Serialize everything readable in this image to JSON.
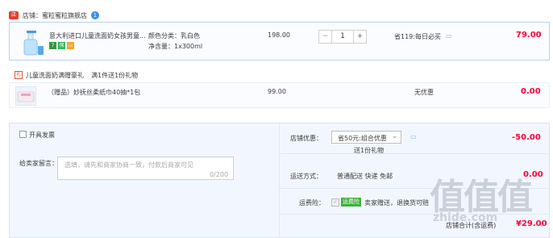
{
  "shop": {
    "label": "店铺：蜜粒蜜粒旗舰店",
    "icon": "shop-icon",
    "badge": "1"
  },
  "item": {
    "title": "意大利进口儿童洗面奶女孩男童...",
    "spec_color": "颜色分类：乳白色",
    "spec_volume": "净含量：1x300ml",
    "unit_price": "198.00",
    "quantity": "1",
    "promo": "省119:每日必买",
    "total": "79.00"
  },
  "gift_section": {
    "title": "儿童洗面奶满赠豪礼",
    "rule": "满1件送1份礼物",
    "gift_name": "（赠品）妙抚丝柔纸巾40抽*1包",
    "gift_price": "99.00",
    "gift_note": "无优惠",
    "gift_total": "0.00"
  },
  "invoice": {
    "label": "开具发票"
  },
  "message": {
    "label": "给卖家留言：",
    "placeholder": "选填，请先和商家协商一致，付款后商家可见",
    "counter": "0/200"
  },
  "discount": {
    "label": "店铺优惠：",
    "selected": "省50元:组合优惠",
    "sub": "送1份礼物",
    "value": "-50.00"
  },
  "delivery": {
    "label": "运送方式：",
    "value": "普通配送 快递 免邮",
    "price": "0.00"
  },
  "insurance": {
    "label": "运费险：",
    "tag": "运费险",
    "text": "卖家赠送，退换货可赔"
  },
  "subtotal": {
    "label": "店铺合计(含运费)",
    "value": "¥29.00"
  },
  "watermark": {
    "text": "值值值",
    "sub": "zhide.com"
  },
  "colors": {
    "accent": "#ff0036",
    "border": "#b7d2ef",
    "panel": "#f2f7ff",
    "green": "#3eb33b"
  }
}
